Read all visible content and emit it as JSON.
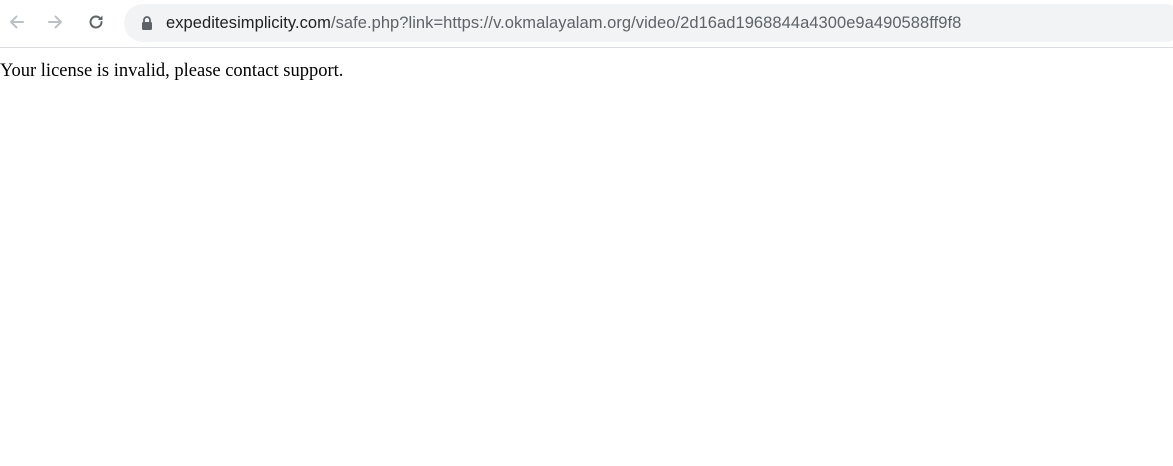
{
  "browser": {
    "back_icon": "arrow-left-icon",
    "forward_icon": "arrow-right-icon",
    "reload_icon": "reload-icon",
    "lock_icon": "lock-icon",
    "url_host": "expeditesimplicity.com",
    "url_path": "/safe.php?link=https://v.okmalayalam.org/video/2d16ad1968844a4300e9a490588ff9f8"
  },
  "page": {
    "message": "Your license is invalid, please contact support."
  },
  "colors": {
    "omnibox_bg": "#f1f3f4",
    "icon_disabled": "#bdc1c6",
    "icon_enabled": "#5f6368",
    "url_host": "#202124",
    "url_path": "#5f6368"
  }
}
